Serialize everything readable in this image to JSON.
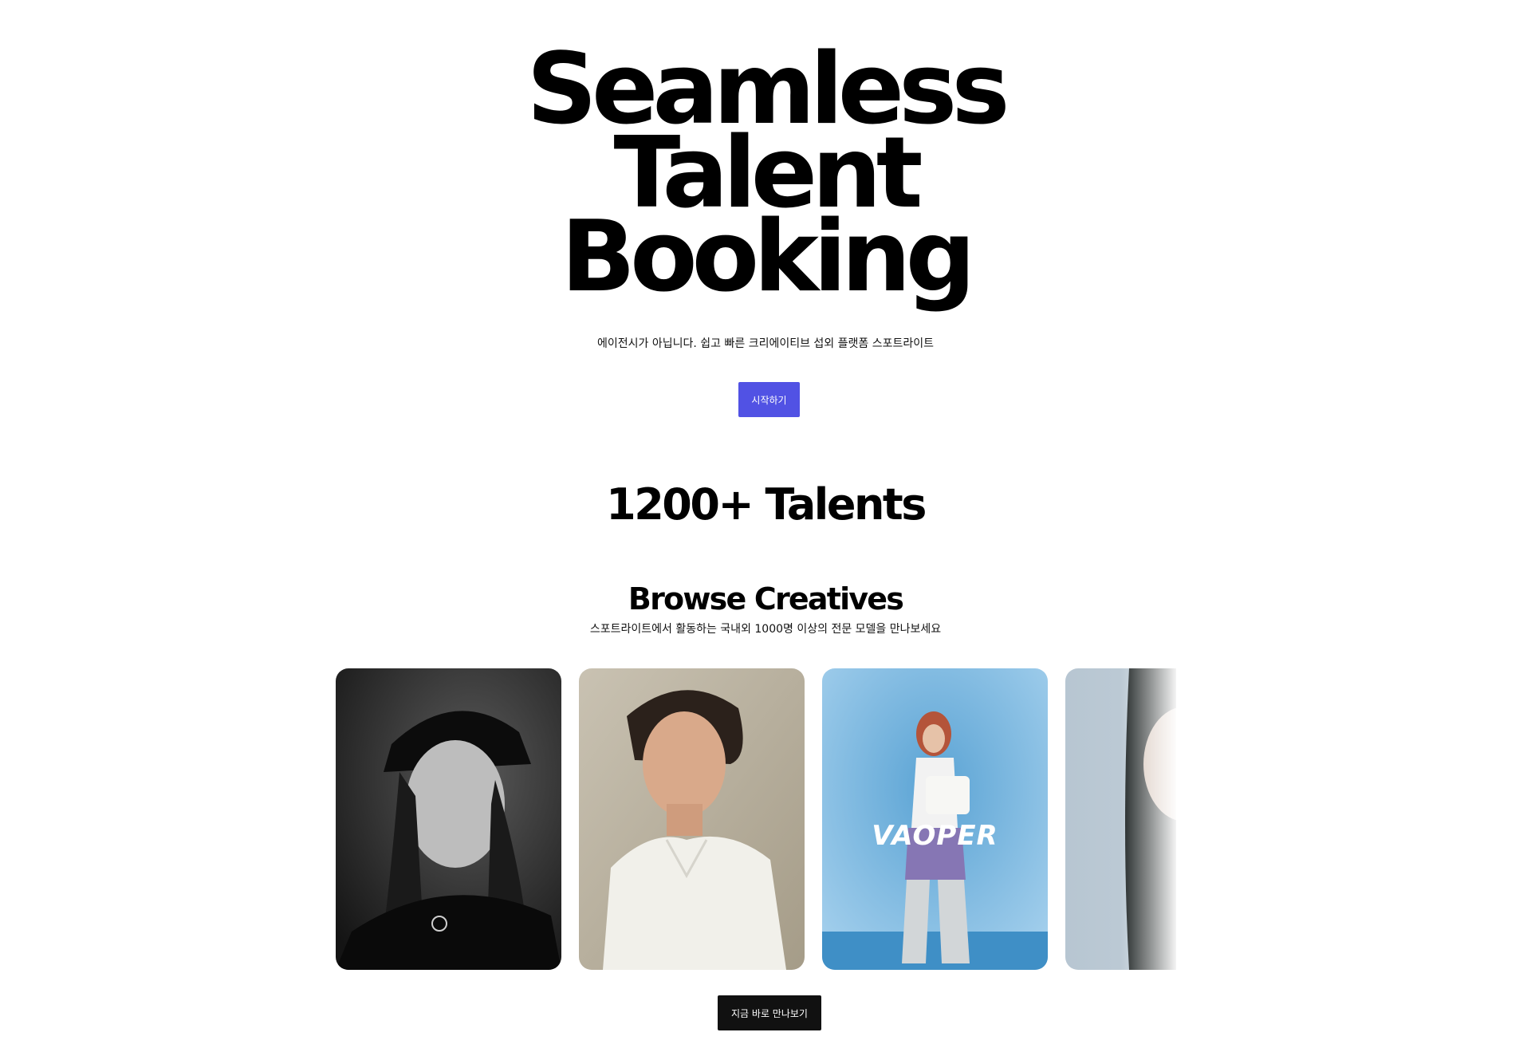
{
  "hero": {
    "title_lines": [
      "Seamless",
      "Talent",
      "Booking"
    ],
    "subtitle": "에이전시가 아닙니다. 쉽고 빠른 크리에이티브 섭외 플랫폼 스포트라이트",
    "cta_label": "시작하기"
  },
  "stats": {
    "talents_label": "1200+ Talents"
  },
  "browse": {
    "title": "Browse Creatives",
    "subtitle": "스포트라이트에서 활동하는 국내외 1000명 이상의 전문 모델을 만나보세요",
    "cards": [
      {
        "name": "creative-1"
      },
      {
        "name": "creative-2"
      },
      {
        "name": "creative-3",
        "caption": "VAOPER"
      },
      {
        "name": "creative-4"
      }
    ],
    "cta_label": "지금 바로 만나보기"
  },
  "colors": {
    "primary_button": "#5152e4",
    "dark_button": "#111111",
    "text": "#000000",
    "background": "#ffffff"
  }
}
